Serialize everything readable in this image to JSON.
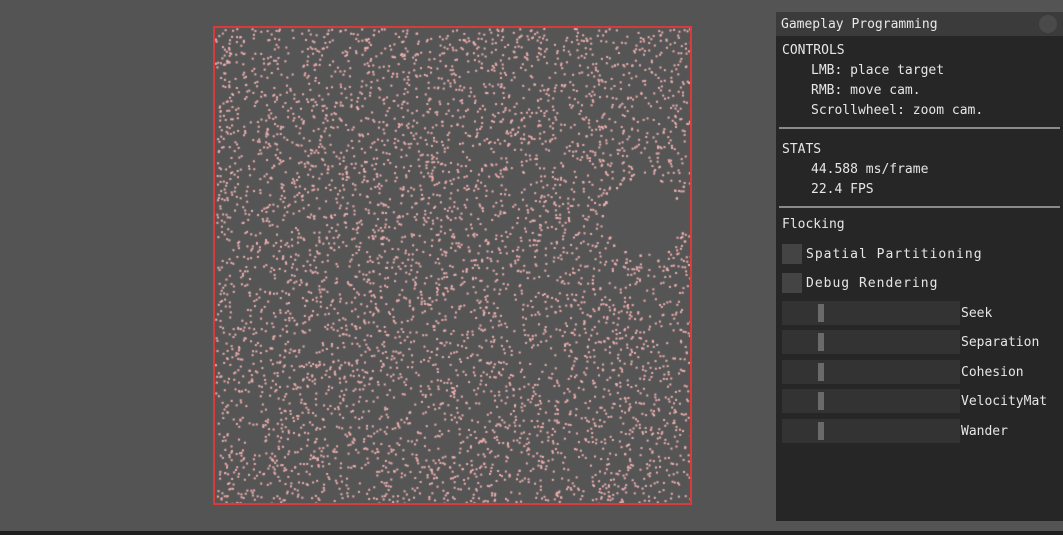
{
  "window": {
    "background": "#545454",
    "world_border_color": "#d93a3a",
    "agent_color": "#f0b0b0"
  },
  "panel": {
    "title": "Gameplay Programming",
    "controls": {
      "heading": "CONTROLS",
      "lines": [
        "LMB: place target",
        "RMB: move cam.",
        "Scrollwheel: zoom cam."
      ]
    },
    "stats": {
      "heading": "STATS",
      "ms_per_frame": "44.588 ms/frame",
      "fps": "22.4 FPS"
    },
    "flocking": {
      "heading": "Flocking",
      "checkboxes": [
        {
          "label": "Spatial Partitioning",
          "checked": false
        },
        {
          "label": "Debug Rendering",
          "checked": false
        }
      ],
      "sliders": [
        {
          "label": "Seek",
          "value": 0.2
        },
        {
          "label": "Separation",
          "value": 0.2
        },
        {
          "label": "Cohesion",
          "value": 0.2
        },
        {
          "label": "VelocityMat",
          "value": 0.2
        },
        {
          "label": "Wander",
          "value": 0.2
        }
      ]
    }
  }
}
